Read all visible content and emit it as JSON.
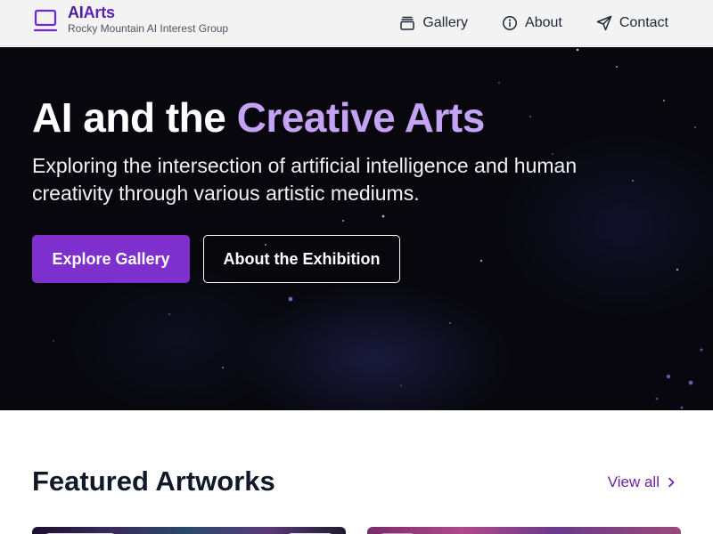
{
  "brand": {
    "name_prefix": "AI",
    "name_suffix": "Arts",
    "subtitle": "Rocky Mountain AI Interest Group",
    "logo_icon": "tv-icon",
    "accent_color": "#6d28d9"
  },
  "nav": {
    "items": [
      {
        "label": "Gallery",
        "icon": "gallery-icon"
      },
      {
        "label": "About",
        "icon": "info-icon"
      },
      {
        "label": "Contact",
        "icon": "send-icon"
      }
    ]
  },
  "hero": {
    "title_plain": "AI and the ",
    "title_accent": "Creative Arts",
    "subtitle": "Exploring the intersection of artificial intelligence and human creativity through various artistic mediums.",
    "primary_button": "Explore Gallery",
    "secondary_button": "About the Exhibition",
    "primary_color": "#7e30cf",
    "accent_color": "#c4a3f5"
  },
  "featured": {
    "title": "Featured Artworks",
    "view_all": "View all"
  }
}
